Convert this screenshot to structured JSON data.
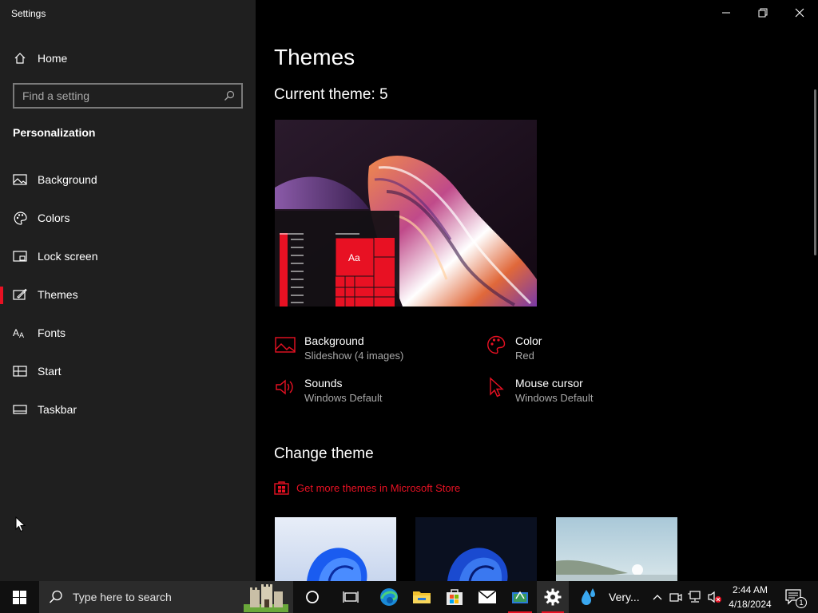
{
  "window": {
    "title": "Settings"
  },
  "sidebar": {
    "home_label": "Home",
    "search_placeholder": "Find a setting",
    "section_header": "Personalization",
    "items": [
      {
        "label": "Background",
        "icon": "picture-icon"
      },
      {
        "label": "Colors",
        "icon": "palette-icon"
      },
      {
        "label": "Lock screen",
        "icon": "lock-screen-icon"
      },
      {
        "label": "Themes",
        "icon": "themes-icon",
        "active": true
      },
      {
        "label": "Fonts",
        "icon": "fonts-icon"
      },
      {
        "label": "Start",
        "icon": "start-icon"
      },
      {
        "label": "Taskbar",
        "icon": "taskbar-icon"
      }
    ]
  },
  "main": {
    "page_title": "Themes",
    "current_theme": "Current theme: 5",
    "preview_sample_text": "Aa",
    "attributes": [
      {
        "title": "Background",
        "value": "Slideshow (4 images)",
        "icon": "picture-icon"
      },
      {
        "title": "Color",
        "value": "Red",
        "icon": "palette-icon"
      },
      {
        "title": "Sounds",
        "value": "Windows Default",
        "icon": "speaker-icon"
      },
      {
        "title": "Mouse cursor",
        "value": "Windows Default",
        "icon": "cursor-icon"
      }
    ],
    "change_theme_title": "Change theme",
    "store_link": "Get more themes in Microsoft Store"
  },
  "taskbar": {
    "search_placeholder": "Type here to search",
    "weather_text": "Very...",
    "time": "2:44 AM",
    "date": "4/18/2024",
    "notification_count": "1"
  },
  "colors": {
    "accent": "#e81123",
    "sidebar_bg": "#1f1f1f",
    "content_bg": "#000000"
  }
}
